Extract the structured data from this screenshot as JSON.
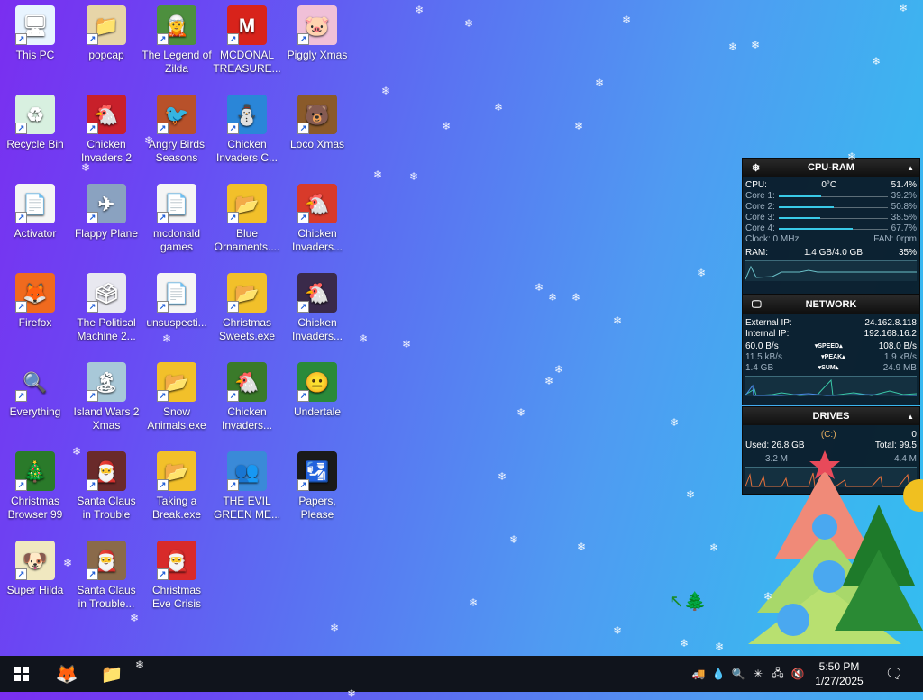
{
  "desktop_icons": [
    {
      "label": "This PC",
      "glyph": "🖥",
      "bg": "#e8f4ff"
    },
    {
      "label": "popcap",
      "glyph": "📁",
      "bg": "#e7d5a8"
    },
    {
      "label": "The Legend of Zilda",
      "glyph": "🧝",
      "bg": "#4d8f3e"
    },
    {
      "label": "MCDONAL TREASURE...",
      "glyph": "M",
      "bg": "#d8231b"
    },
    {
      "label": "Piggly Xmas",
      "glyph": "🐷",
      "bg": "#f0c0d8"
    },
    {
      "label": "Recycle Bin",
      "glyph": "♻",
      "bg": "#d8f0e0"
    },
    {
      "label": "Chicken Invaders 2",
      "glyph": "🐔",
      "bg": "#c8202a"
    },
    {
      "label": "Angry Birds Seasons",
      "glyph": "🐦",
      "bg": "#b8512a"
    },
    {
      "label": "Chicken Invaders C...",
      "glyph": "⛄",
      "bg": "#2a86d8"
    },
    {
      "label": "Loco Xmas",
      "glyph": "🐻",
      "bg": "#8a5a2a"
    },
    {
      "label": "Activator",
      "glyph": "📄",
      "bg": "#f5f5f5"
    },
    {
      "label": "Flappy Plane",
      "glyph": "✈",
      "bg": "#8aa2c0"
    },
    {
      "label": "mcdonald games",
      "glyph": "📄",
      "bg": "#f5f5f5"
    },
    {
      "label": "Blue Ornaments....",
      "glyph": "📂",
      "bg": "#f2c02a"
    },
    {
      "label": "Chicken Invaders...",
      "glyph": "🐔",
      "bg": "#d83a2a"
    },
    {
      "label": "Firefox",
      "glyph": "🦊",
      "bg": "#f06a1e"
    },
    {
      "label": "The Political Machine 2...",
      "glyph": "🗳",
      "bg": "#e8e8f0"
    },
    {
      "label": "unsuspecti...",
      "glyph": "📄",
      "bg": "#f5f5f5"
    },
    {
      "label": "Christmas Sweets.exe",
      "glyph": "📂",
      "bg": "#f2c02a"
    },
    {
      "label": "Chicken Invaders...",
      "glyph": "🐔",
      "bg": "#3a2a4a"
    },
    {
      "label": "Everything",
      "glyph": "🔍",
      "bg": "#ffffff00"
    },
    {
      "label": "Island Wars 2 Xmas",
      "glyph": "🏝",
      "bg": "#a8c8d8"
    },
    {
      "label": "Snow Animals.exe",
      "glyph": "📂",
      "bg": "#f2c02a"
    },
    {
      "label": "Chicken Invaders...",
      "glyph": "🐔",
      "bg": "#3a7a2a"
    },
    {
      "label": "Undertale",
      "glyph": "😐",
      "bg": "#2a8a3a"
    },
    {
      "label": "Christmas Browser 99",
      "glyph": "🎄",
      "bg": "#2a7a2a"
    },
    {
      "label": "Santa Claus in Trouble",
      "glyph": "🎅",
      "bg": "#6a2a2a"
    },
    {
      "label": "Taking a Break.exe",
      "glyph": "📂",
      "bg": "#f2c02a"
    },
    {
      "label": "THE EVIL GREEN ME...",
      "glyph": "👥",
      "bg": "#3a8ad8"
    },
    {
      "label": "Papers, Please",
      "glyph": "🛂",
      "bg": "#1a1a1a"
    },
    {
      "label": "Super Hilda",
      "glyph": "🐶",
      "bg": "#f0e8c0"
    },
    {
      "label": "Santa Claus in Trouble... A...",
      "glyph": "🎅",
      "bg": "#8a6a4a"
    },
    {
      "label": "Christmas Eve Crisis",
      "glyph": "🎅",
      "bg": "#d82a2a"
    }
  ],
  "cpu_ram": {
    "title": "CPU-RAM",
    "cpu_label": "CPU:",
    "cpu_temp": "0°C",
    "cpu_pct": "51.4%",
    "cores": [
      {
        "label": "Core 1:",
        "value": "39.2%",
        "frac": 0.392
      },
      {
        "label": "Core 2:",
        "value": "50.8%",
        "frac": 0.508
      },
      {
        "label": "Core 3:",
        "value": "38.5%",
        "frac": 0.385
      },
      {
        "label": "Core 4:",
        "value": "67.7%",
        "frac": 0.677
      }
    ],
    "clock": "Clock: 0 MHz",
    "fan": "FAN: 0rpm",
    "ram_label": "RAM:",
    "ram_value": "1.4 GB/4.0 GB",
    "ram_pct": "35%"
  },
  "network": {
    "title": "NETWORK",
    "ext_label": "External IP:",
    "ext_ip": "24.162.8.118",
    "int_label": "Internal IP:",
    "int_ip": "192.168.16.2",
    "speed_down": "60.0 B/s",
    "speed_label": "SPEED",
    "speed_up": "108.0 B/s",
    "peak_down": "11.5 kB/s",
    "peak_label": "PEAK",
    "peak_up": "1.9 kB/s",
    "sum_down": "1.4 GB",
    "sum_label": "SUM",
    "sum_up": "24.9 MB"
  },
  "drives": {
    "title": "DRIVES",
    "drive": "(C:)",
    "pct": "0",
    "used": "Used: 26.8 GB",
    "total": "Total: 99.5",
    "read": "3.2 M",
    "write": "4.4 M"
  },
  "taskbar": {
    "time": "5:50 PM",
    "date": "1/27/2025"
  }
}
